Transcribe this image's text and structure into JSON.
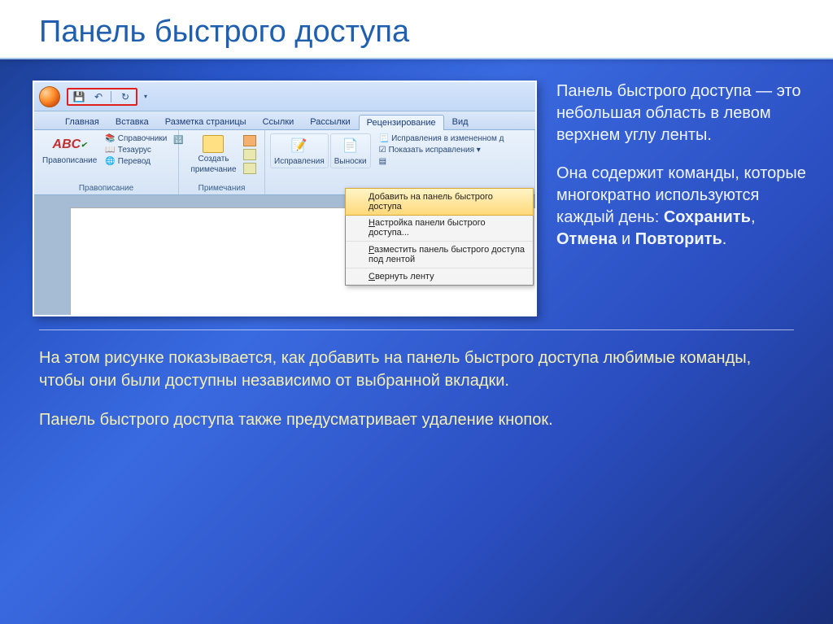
{
  "slide": {
    "title": "Панель быстрого доступа"
  },
  "qat": {
    "save": "💾",
    "undo": "↶",
    "redo": "↻",
    "drop": "▾"
  },
  "tabs": {
    "home": "Главная",
    "insert": "Вставка",
    "layout": "Разметка страницы",
    "refs": "Ссылки",
    "mail": "Рассылки",
    "review": "Рецензирование",
    "view": "Вид"
  },
  "groups": {
    "proof": {
      "spellcheck": "Правописание",
      "items": {
        "dict": "Справочники",
        "thes": "Тезаурус",
        "trans": "Перевод"
      },
      "label": "Правописание"
    },
    "notes": {
      "new": "Создать",
      "new2": "примечание",
      "label": "Примечания"
    },
    "track": {
      "changes": "Исправления",
      "balloons": "Выноски",
      "opt1": "Исправления в измененном д",
      "opt2": "Показать исправления ▾"
    }
  },
  "menu": {
    "i1_pre": "Добавить на панель быстрого доступа",
    "i2_u": "Н",
    "i2_rest": "астройка панели быстрого доступа...",
    "i3_u": "Р",
    "i3_rest": "азместить панель быстрого доступа под лентой",
    "i4_u": "С",
    "i4_rest": "вернуть ленту"
  },
  "side": {
    "p1": "Панель быстрого доступа — это небольшая область в левом верхнем углу ленты.",
    "p2a": "Она содержит команды, которые многократно используются каждый день: ",
    "save": "Сохранить",
    "comma": ", ",
    "undo": "Отмена",
    "and": " и ",
    "redo": "Повторить",
    "dot": "."
  },
  "below": {
    "p1": "На этом рисунке показывается, как добавить на панель быстрого доступа любимые команды, чтобы они были доступны независимо от выбранной вкладки.",
    "p2": "Панель быстрого доступа также предусматривает удаление кнопок."
  }
}
